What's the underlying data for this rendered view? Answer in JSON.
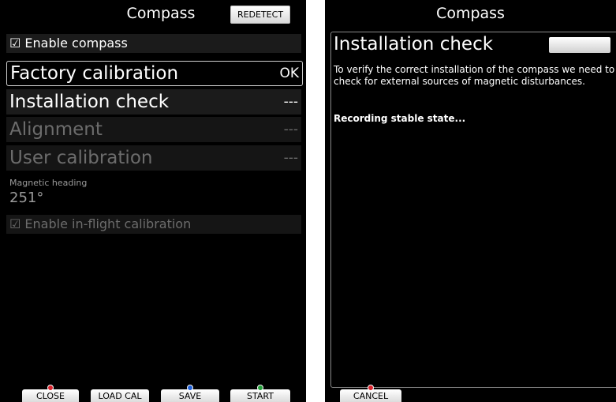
{
  "left_screen": {
    "title": "Compass",
    "redetect_button": "REDETECT",
    "enable_compass": {
      "label": "☑ Enable compass",
      "checked": true
    },
    "items": [
      {
        "label": "Factory calibration",
        "value": "OK",
        "state": "selected"
      },
      {
        "label": "Installation check",
        "value": "---",
        "state": "normal"
      },
      {
        "label": "Alignment",
        "value": "---",
        "state": "disabled"
      },
      {
        "label": "User calibration",
        "value": "---",
        "state": "disabled"
      }
    ],
    "magnetic_heading": {
      "label": "Magnetic heading",
      "value": "251°"
    },
    "enable_inflight": {
      "label": "☑ Enable in-flight calibration",
      "checked": true,
      "state": "disabled"
    },
    "buttons": {
      "close": "CLOSE",
      "load_cal": "LOAD CAL",
      "save": "SAVE",
      "start": "START"
    }
  },
  "right_screen": {
    "title": "Compass",
    "panel": {
      "title": "Installation check",
      "description": "To verify the correct installation of the compass we need to check for external sources of magnetic disturbances.",
      "status": "Recording stable state..."
    },
    "buttons": {
      "cancel": "CANCEL"
    }
  },
  "colors": {
    "background": "#000000",
    "disabled_text": "#6c6c6c",
    "button_red_dot": "#d9232d",
    "button_blue_dot": "#1e5fd8",
    "button_green_dot": "#23a03a"
  }
}
